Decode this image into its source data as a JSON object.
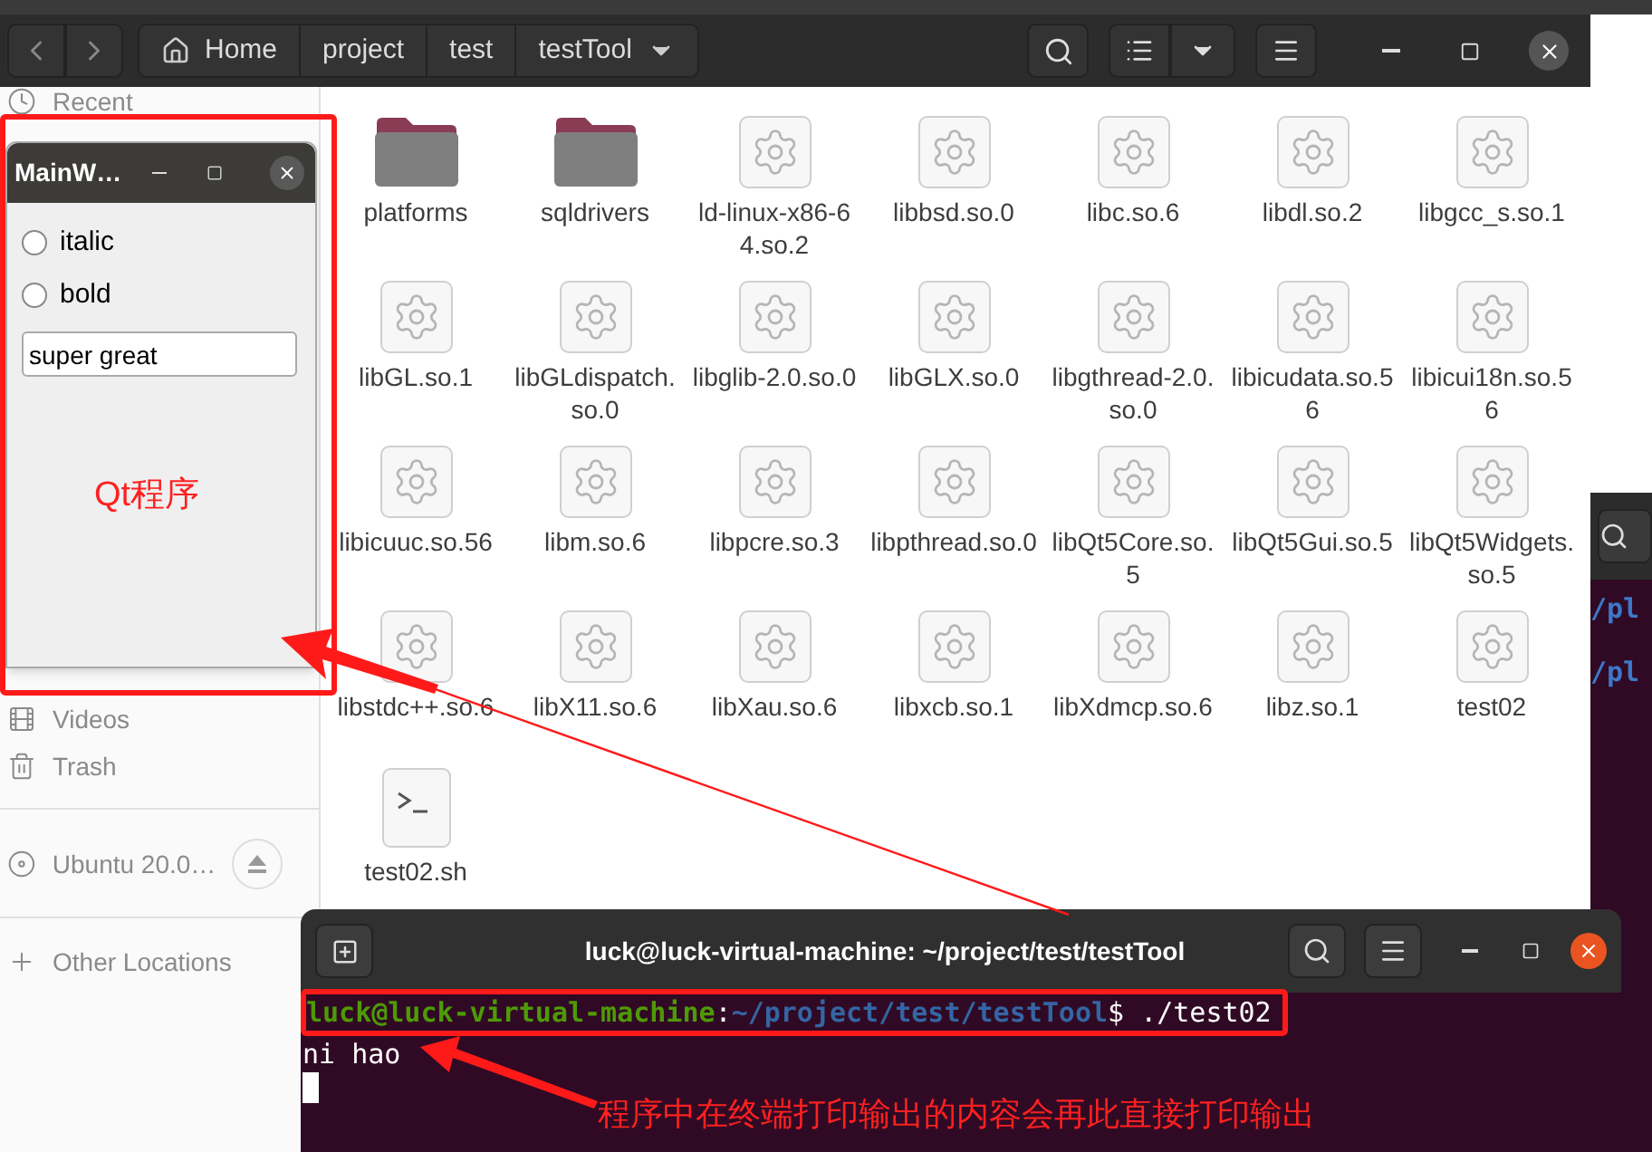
{
  "file_manager": {
    "breadcrumbs": [
      "Home",
      "project",
      "test",
      "testTool"
    ],
    "sidebar": [
      {
        "label": "Recent",
        "kind": "recent"
      },
      {
        "label": "Videos",
        "kind": "videos"
      },
      {
        "label": "Trash",
        "kind": "trash"
      },
      {
        "label": "Ubuntu 20.0…",
        "kind": "drive"
      },
      {
        "label": "Other Locations",
        "kind": "other"
      }
    ],
    "files": [
      {
        "name": "platforms",
        "kind": "folder"
      },
      {
        "name": "sqldrivers",
        "kind": "folder"
      },
      {
        "name": "ld-linux-x86-64.so.2",
        "kind": "library"
      },
      {
        "name": "libbsd.so.0",
        "kind": "library"
      },
      {
        "name": "libc.so.6",
        "kind": "library"
      },
      {
        "name": "libdl.so.2",
        "kind": "library"
      },
      {
        "name": "libgcc_s.so.1",
        "kind": "library"
      },
      {
        "name": "libGL.so.1",
        "kind": "library"
      },
      {
        "name": "libGLdispatch.so.0",
        "kind": "library"
      },
      {
        "name": "libglib-2.0.so.0",
        "kind": "library"
      },
      {
        "name": "libGLX.so.0",
        "kind": "library"
      },
      {
        "name": "libgthread-2.0.so.0",
        "kind": "library"
      },
      {
        "name": "libicudata.so.56",
        "kind": "library"
      },
      {
        "name": "libicui18n.so.56",
        "kind": "library"
      },
      {
        "name": "libicuuc.so.56",
        "kind": "library"
      },
      {
        "name": "libm.so.6",
        "kind": "library"
      },
      {
        "name": "libpcre.so.3",
        "kind": "library"
      },
      {
        "name": "libpthread.so.0",
        "kind": "library"
      },
      {
        "name": "libQt5Core.so.5",
        "kind": "library"
      },
      {
        "name": "libQt5Gui.so.5",
        "kind": "library"
      },
      {
        "name": "libQt5Widgets.so.5",
        "kind": "library"
      },
      {
        "name": "libstdc++.so.6",
        "kind": "library"
      },
      {
        "name": "libX11.so.6",
        "kind": "library"
      },
      {
        "name": "libXau.so.6",
        "kind": "library"
      },
      {
        "name": "libxcb.so.1",
        "kind": "library"
      },
      {
        "name": "libXdmcp.so.6",
        "kind": "library"
      },
      {
        "name": "libz.so.1",
        "kind": "library"
      },
      {
        "name": "test02",
        "kind": "library"
      },
      {
        "name": "test02.sh",
        "kind": "script"
      }
    ]
  },
  "qt_window": {
    "title": "MainW…",
    "options": [
      {
        "label": "italic",
        "selected": false
      },
      {
        "label": "bold",
        "selected": false
      }
    ],
    "text_value": "super great"
  },
  "background_terminal": {
    "lines": [
      "/pl",
      "/pl"
    ]
  },
  "terminal": {
    "title": "luck@luck-virtual-machine: ~/project/test/testTool",
    "prompt_user": "luck@luck-virtual-machine",
    "prompt_sep": ":",
    "prompt_path": "~/project/test/testTool",
    "command": "$ ./test02",
    "output": "ni hao"
  },
  "annotations": {
    "qt_label": "Qt程序",
    "terminal_note": "程序中在终端打印输出的内容会再此直接打印输出"
  }
}
